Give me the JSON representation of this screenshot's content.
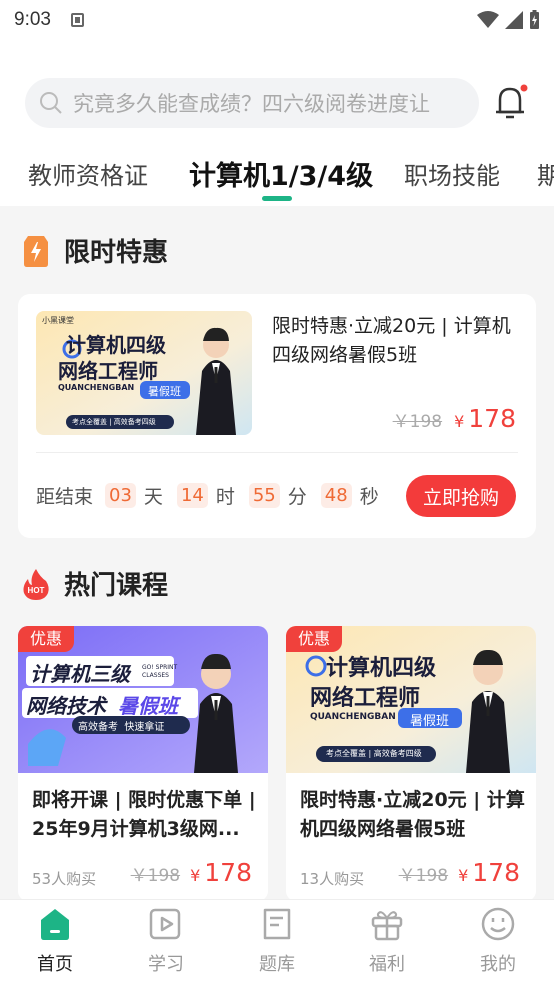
{
  "status_bar": {
    "time": "9:03"
  },
  "search": {
    "placeholder": "究竟多久能查成绩？四六级阅卷进度让"
  },
  "tabs": [
    {
      "label": "教师资格证"
    },
    {
      "label": "计算机1/3/4级"
    },
    {
      "label": "职场技能"
    },
    {
      "label": "期"
    }
  ],
  "flash_sale": {
    "section_title": "限时特惠",
    "course": {
      "title": "限时特惠·立减20元 | 计算机四级网络暑假5班",
      "old_price": "￥198",
      "currency": "¥",
      "price": "178",
      "thumb": {
        "brand": "小黑课堂",
        "line1": "计算机四级",
        "line2": "网络工程师",
        "sub": "QUANCHENGBAN",
        "tag": "暑假班",
        "footer": "考点全覆盖 | 高效备考四级"
      }
    },
    "countdown": {
      "prefix": "距结束",
      "days": "03",
      "days_label": "天",
      "hours": "14",
      "hours_label": "时",
      "minutes": "55",
      "minutes_label": "分",
      "seconds": "48",
      "seconds_label": "秒"
    },
    "buy_label": "立即抢购"
  },
  "hot": {
    "section_title": "热门课程",
    "courses": [
      {
        "badge": "优惠",
        "title": "即将开课 | 限时优惠下单 | 25年9月计算机3级网...",
        "bought": "53人购买",
        "old_price": "￥198",
        "currency": "¥",
        "price": "178",
        "thumb": {
          "line1": "计算机三级",
          "line2a": "网络技术",
          "line2b": "暑假班",
          "tag": "GO! SPRINT CLASSES",
          "footer": "高效备考  快速拿证"
        }
      },
      {
        "badge": "优惠",
        "title": "限时特惠·立减20元 | 计算机四级网络暑假5班",
        "bought": "13人购买",
        "old_price": "￥198",
        "currency": "¥",
        "price": "178",
        "thumb": {
          "line1": "计算机四级",
          "line2": "网络工程师",
          "sub": "QUANCHENGBAN",
          "tag": "暑假班",
          "footer": "考点全覆盖 | 高效备考四级"
        }
      }
    ]
  },
  "bottom_nav": [
    {
      "label": "首页",
      "icon": "home-icon"
    },
    {
      "label": "学习",
      "icon": "play-icon"
    },
    {
      "label": "题库",
      "icon": "document-icon"
    },
    {
      "label": "福利",
      "icon": "gift-icon"
    },
    {
      "label": "我的",
      "icon": "smiley-icon"
    }
  ],
  "colors": {
    "accent": "#1db486",
    "price": "#f0413c",
    "countdown": "#ef6a35",
    "buy_button": "#f33b3b"
  }
}
